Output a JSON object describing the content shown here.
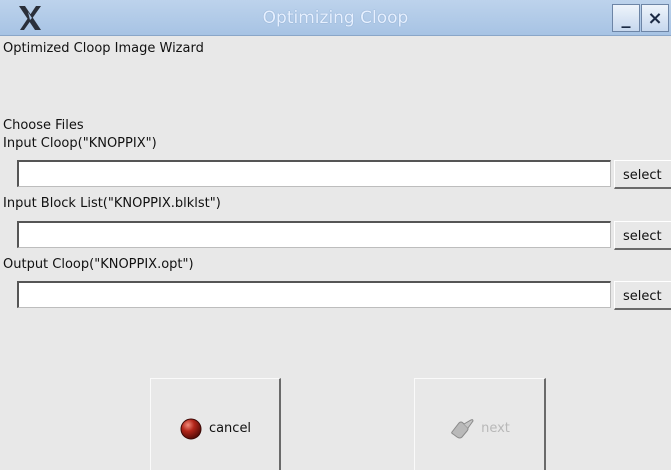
{
  "window": {
    "title": "Optimizing Cloop",
    "minimize_label": "_",
    "close_label": "×"
  },
  "wizard": {
    "heading": "Optimized Cloop Image Wizard",
    "section_label": "Choose  Files",
    "fields": [
      {
        "label": "Input Cloop(\"KNOPPIX\")",
        "value": "",
        "button": "select"
      },
      {
        "label": "Input Block List(\"KNOPPIX.blklst\")",
        "value": "",
        "button": "select"
      },
      {
        "label": "Output Cloop(\"KNOPPIX.opt\")",
        "value": "",
        "button": "select"
      }
    ]
  },
  "buttons": {
    "cancel_label": "cancel",
    "next_label": "next"
  },
  "icons": {
    "app": "x-logo-icon",
    "cancel": "red-ball-icon",
    "next": "hand-pointer-icon"
  },
  "colors": {
    "titlebar": "#a7c3e4",
    "window_bg": "#e8e8e8",
    "cancel_icon": "#8b1a12"
  }
}
